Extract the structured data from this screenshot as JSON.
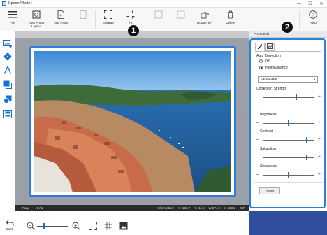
{
  "window": {
    "title": "Epson Photo+",
    "minimize": "—",
    "maximize": "☐",
    "close": "✕"
  },
  "toolbar": {
    "file": "File",
    "auto_photo_layout": "Auto Photo Layout",
    "add_page": "Add Page",
    "enlarge": "Enlarge",
    "fit": "Fit",
    "rotate": "Rotate 90°",
    "delete": "Delete",
    "help": "Help"
  },
  "statusbar": {
    "page_label": "Page",
    "page_value": "1 / 1",
    "info_label": "Information:",
    "x": "X:-183.7",
    "y": "Y:-44.6",
    "w": "W:274.8",
    "h": "H:183.2",
    "deg": "0.0°"
  },
  "bottom": {
    "back_label": "Back",
    "zoom_level": 0.2
  },
  "panel": {
    "tab_label": "Photo Edit",
    "auto_correction_label": "Auto Correction",
    "option_off": "Off",
    "option_photoenhance": "PhotoEnhance",
    "scene_select": "Landscape",
    "correction_strength_label": "Correction Strength",
    "brightness_label": "Brightness",
    "contrast_label": "Contrast",
    "saturation_label": "Saturation",
    "sharpness_label": "Sharpness",
    "reset_label": "Reset",
    "levels": {
      "correction_strength": 0.65,
      "brightness": 0.5,
      "contrast": 0.85,
      "saturation": 0.85,
      "sharpness": 0.5
    }
  },
  "callouts": {
    "one": "1",
    "two": "2"
  },
  "colors": {
    "accent": "#2d7ddc",
    "slider": "#1a6fd0",
    "statusbar": "#2b2b2b"
  }
}
